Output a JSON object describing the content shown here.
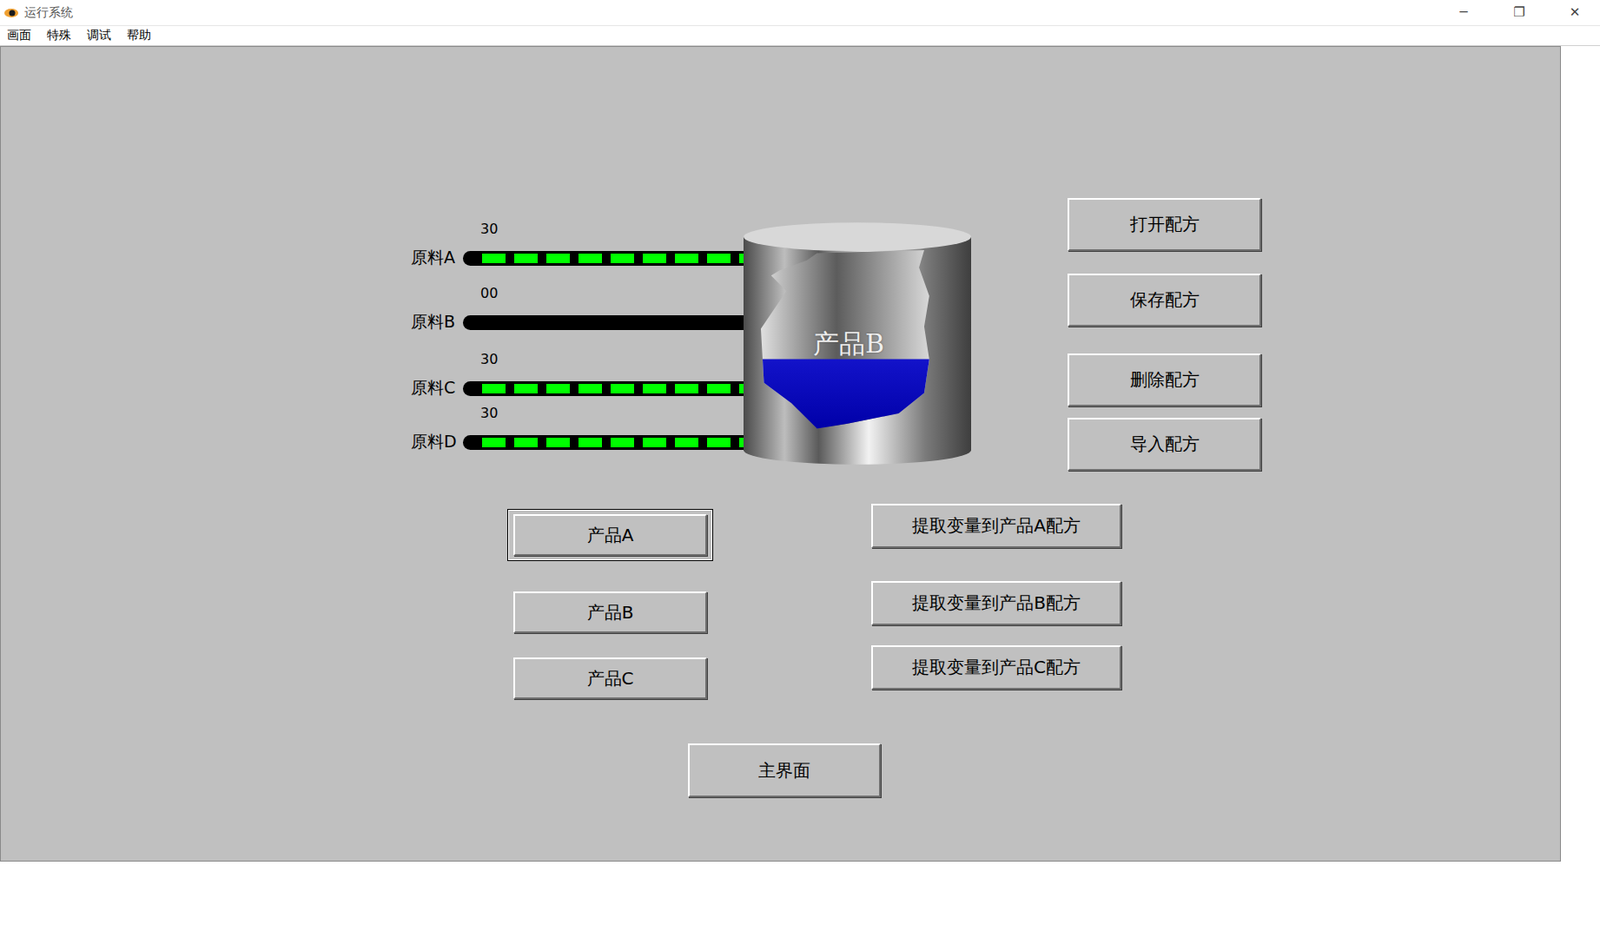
{
  "window": {
    "title": "运行系统",
    "controls": [
      "─",
      "❐",
      "✕"
    ]
  },
  "menu": [
    "画面",
    "特殊",
    "调试",
    "帮助"
  ],
  "materials": [
    {
      "label": "原料A",
      "value": "30",
      "flowing": true
    },
    {
      "label": "原料B",
      "value": "00",
      "flowing": false
    },
    {
      "label": "原料C",
      "value": "30",
      "flowing": true
    },
    {
      "label": "原料D",
      "value": "30",
      "flowing": true
    }
  ],
  "tank": {
    "product": "产品B",
    "level": 0.39
  },
  "recipe_buttons": [
    "打开配方",
    "保存配方",
    "删除配方",
    "导入配方"
  ],
  "products": [
    {
      "label": "产品A",
      "selected": true
    },
    {
      "label": "产品B",
      "selected": false
    },
    {
      "label": "产品C",
      "selected": false
    }
  ],
  "extract_buttons": [
    "提取变量到产品A配方",
    "提取变量到产品B配方",
    "提取变量到产品C配方"
  ],
  "main_button": "主界面"
}
